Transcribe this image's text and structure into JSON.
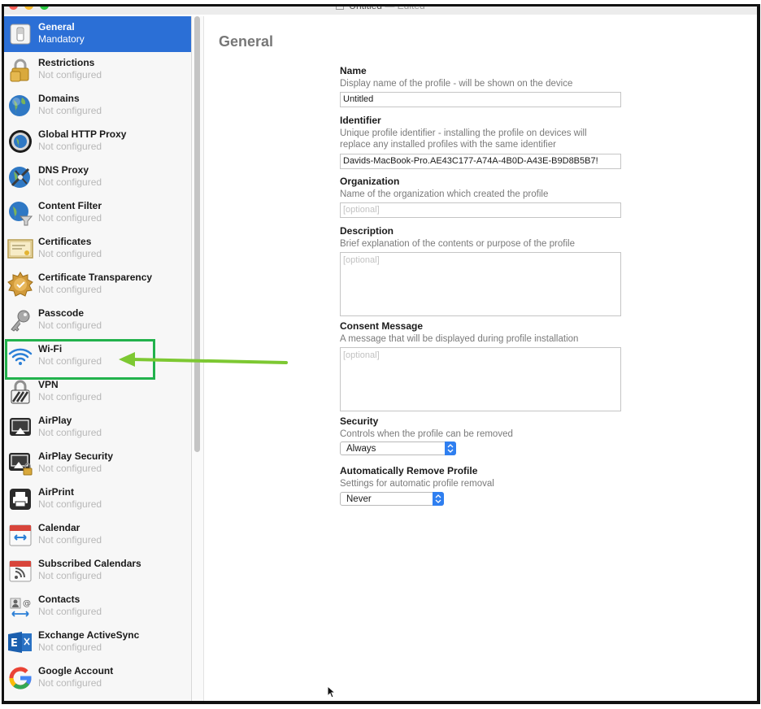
{
  "window": {
    "title": "Untitled",
    "edited": "— Edited"
  },
  "sidebar": {
    "items": [
      {
        "label": "General",
        "sub": "Mandatory",
        "icon": "switch-icon"
      },
      {
        "label": "Restrictions",
        "sub": "Not configured",
        "icon": "padlock-icon"
      },
      {
        "label": "Domains",
        "sub": "Not configured",
        "icon": "globe-icon"
      },
      {
        "label": "Global HTTP Proxy",
        "sub": "Not configured",
        "icon": "proxy-globe-icon"
      },
      {
        "label": "DNS Proxy",
        "sub": "Not configured",
        "icon": "dns-proxy-globe-icon"
      },
      {
        "label": "Content Filter",
        "sub": "Not configured",
        "icon": "filter-globe-icon"
      },
      {
        "label": "Certificates",
        "sub": "Not configured",
        "icon": "certificate-icon"
      },
      {
        "label": "Certificate Transparency",
        "sub": "Not configured",
        "icon": "badge-seal-icon"
      },
      {
        "label": "Passcode",
        "sub": "Not configured",
        "icon": "key-icon"
      },
      {
        "label": "Wi-Fi",
        "sub": "Not configured",
        "icon": "wifi-icon"
      },
      {
        "label": "VPN",
        "sub": "Not configured",
        "icon": "vpn-lock-icon"
      },
      {
        "label": "AirPlay",
        "sub": "Not configured",
        "icon": "airplay-icon"
      },
      {
        "label": "AirPlay Security",
        "sub": "Not configured",
        "icon": "airplay-lock-icon"
      },
      {
        "label": "AirPrint",
        "sub": "Not configured",
        "icon": "printer-icon"
      },
      {
        "label": "Calendar",
        "sub": "Not configured",
        "icon": "calendar-icon"
      },
      {
        "label": "Subscribed Calendars",
        "sub": "Not configured",
        "icon": "subscribed-calendar-icon"
      },
      {
        "label": "Contacts",
        "sub": "Not configured",
        "icon": "contacts-icon"
      },
      {
        "label": "Exchange ActiveSync",
        "sub": "Not configured",
        "icon": "exchange-icon"
      },
      {
        "label": "Google Account",
        "sub": "Not configured",
        "icon": "google-icon"
      }
    ]
  },
  "main": {
    "title": "General",
    "name": {
      "title": "Name",
      "desc": "Display name of the profile - will be shown on the device",
      "value": "Untitled"
    },
    "identifier": {
      "title": "Identifier",
      "desc1": "Unique profile identifier - installing the profile on devices will",
      "desc2": "replace any installed profiles with the same identifier",
      "value": "Davids-MacBook-Pro.AE43C177-A74A-4B0D-A43E-B9D8B5B7!"
    },
    "organization": {
      "title": "Organization",
      "desc": "Name of the organization which created the profile",
      "placeholder": "[optional]"
    },
    "description": {
      "title": "Description",
      "desc": "Brief explanation of the contents or purpose of the profile",
      "placeholder": "[optional]"
    },
    "consent": {
      "title": "Consent Message",
      "desc": "A message that will be displayed during profile installation",
      "placeholder": "[optional]"
    },
    "security": {
      "title": "Security",
      "desc": "Controls when the profile can be removed",
      "value": "Always"
    },
    "auto_remove": {
      "title": "Automatically Remove Profile",
      "desc": "Settings for automatic profile removal",
      "value": "Never"
    }
  },
  "colors": {
    "selection": "#2b6fd6",
    "annotation_box": "#22b24c",
    "annotation_arrow": "#7dc832",
    "popup_stepper": "#2f7ff0"
  }
}
